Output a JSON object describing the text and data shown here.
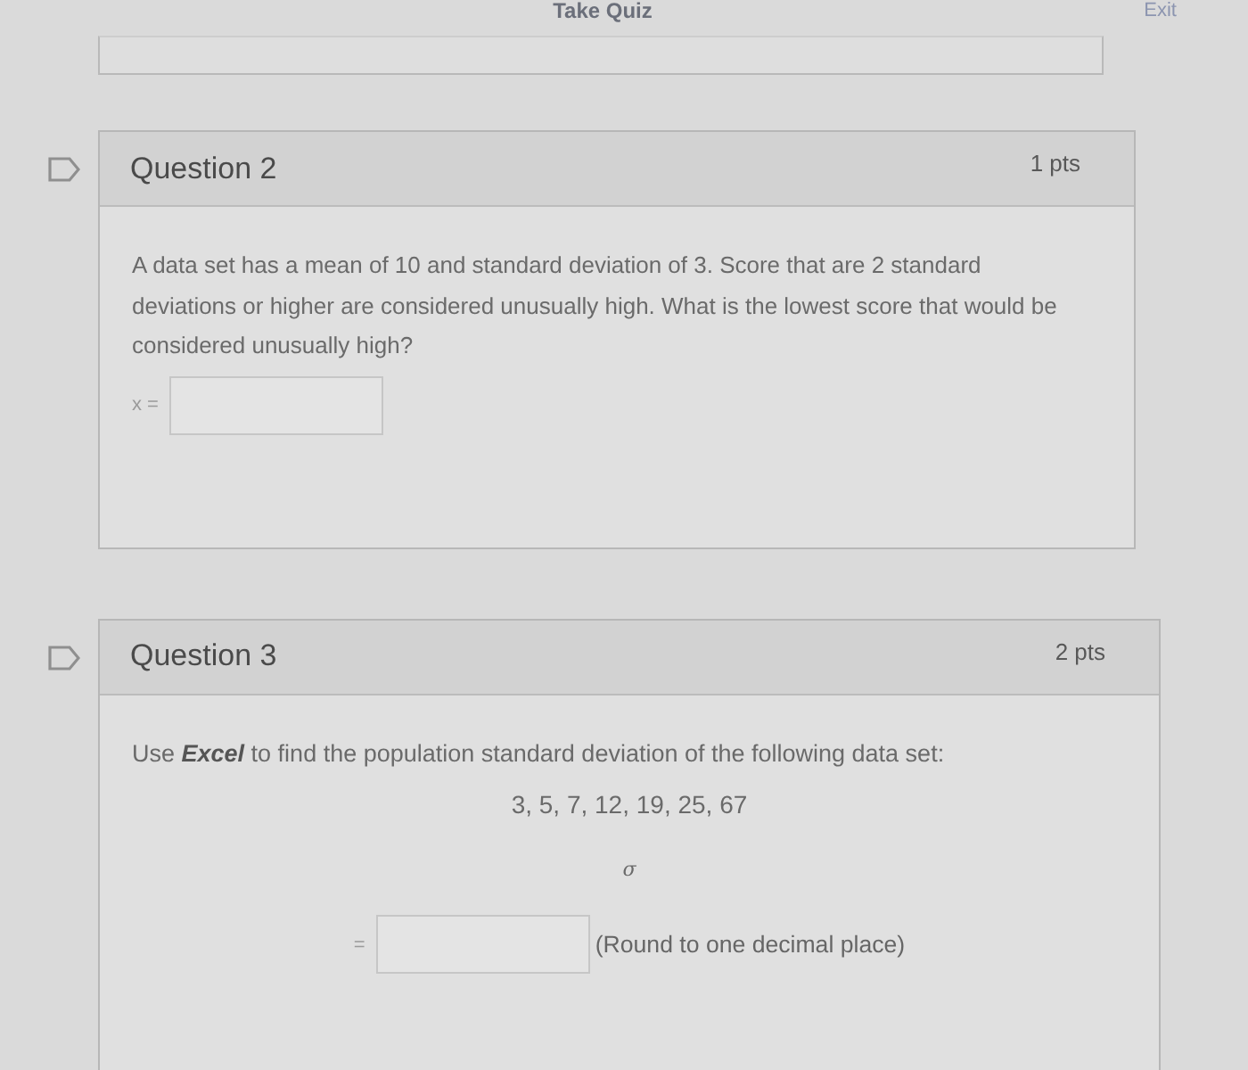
{
  "header": {
    "title": "Take Quiz",
    "exit": "Exit"
  },
  "questions": [
    {
      "title": "Question 2",
      "points": "1 pts",
      "flagged": false,
      "body": [
        {
          "kind": "paragraph",
          "text": "A data set has a mean of 10 and standard deviation of 3. Score that are 2 standard deviations or higher are considered unusually high. What is the lowest score that would be considered unusually high?"
        },
        {
          "kind": "answer",
          "label": "x ="
        }
      ]
    },
    {
      "title": "Question 3",
      "points": "2 pts",
      "flagged": false,
      "body": [
        {
          "kind": "paragraph",
          "text": "Use **Excel** to find the population standard deviation of the following data set:"
        },
        {
          "kind": "values",
          "text": "3, 5, 7, 12, 19, 25, 67"
        },
        {
          "kind": "symbol",
          "text": "σ"
        },
        {
          "kind": "centered_answer",
          "label": "=",
          "note": "(Round to one decimal place)"
        }
      ]
    }
  ]
}
